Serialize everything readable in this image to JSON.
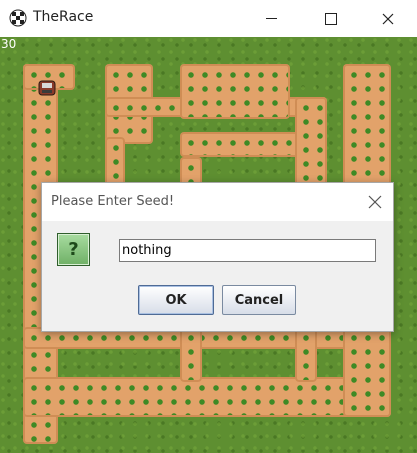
{
  "window": {
    "title": "TheRace",
    "minimize_symbol": "—",
    "maximize_symbol": "☐",
    "close_symbol": "✕"
  },
  "game": {
    "score": "30"
  },
  "dialog": {
    "title": "Please Enter Seed!",
    "close_symbol": "✕",
    "question_glyph": "?",
    "input_value": "nothing",
    "ok_label": "OK",
    "cancel_label": "Cancel"
  },
  "colors": {
    "grass": "#5e8f31",
    "path": "#e2a26a",
    "dialog_bg": "#f0f0f0"
  },
  "icons": [
    "app-icon",
    "question-icon",
    "car-icon",
    "close-icon",
    "minimize-icon",
    "maximize-icon"
  ]
}
